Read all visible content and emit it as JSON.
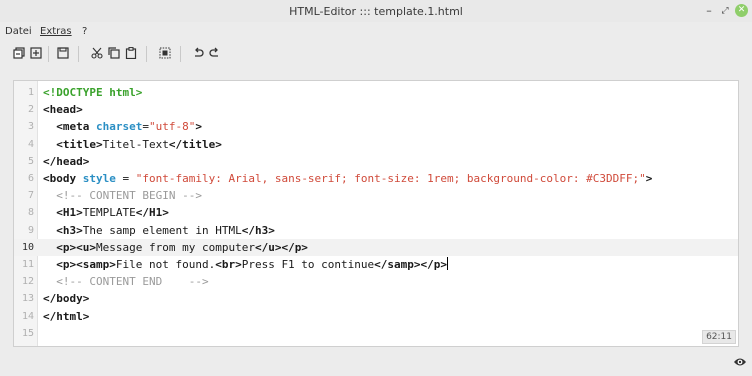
{
  "window": {
    "title": "HTML-Editor ::: template.1.html",
    "controls": {
      "minimize": "–",
      "maximize": "⤢",
      "close": "✕"
    }
  },
  "menu": [
    {
      "label": "Datei"
    },
    {
      "label": "Extras"
    },
    {
      "label": "?"
    }
  ],
  "toolbar": [
    {
      "icon": "duplicate-window-icon"
    },
    {
      "icon": "new-file-icon"
    },
    {
      "icon": "save-icon"
    },
    {
      "icon": "cut-icon"
    },
    {
      "icon": "copy-icon"
    },
    {
      "icon": "paste-icon"
    },
    {
      "icon": "select-all-icon"
    },
    {
      "icon": "undo-icon"
    },
    {
      "icon": "redo-icon"
    }
  ],
  "editor": {
    "current_line": 10,
    "cursor_position": "62:11",
    "line_numbers": [
      "1",
      "2",
      "3",
      "4",
      "5",
      "6",
      "7",
      "8",
      "9",
      "10",
      "11",
      "12",
      "13",
      "14",
      "15"
    ],
    "lines": [
      [
        {
          "t": "doctype",
          "v": "<!DOCTYPE html>"
        }
      ],
      [
        {
          "t": "tag",
          "v": "<head>"
        }
      ],
      [
        {
          "t": "txt",
          "v": "  "
        },
        {
          "t": "tag",
          "v": "<meta "
        },
        {
          "t": "attr",
          "v": "charset"
        },
        {
          "t": "txt",
          "v": "="
        },
        {
          "t": "str",
          "v": "\"utf-8\""
        },
        {
          "t": "tag",
          "v": ">"
        }
      ],
      [
        {
          "t": "txt",
          "v": "  "
        },
        {
          "t": "tag",
          "v": "<title>"
        },
        {
          "t": "txt",
          "v": "Titel-Text"
        },
        {
          "t": "tag",
          "v": "</title>"
        }
      ],
      [
        {
          "t": "tag",
          "v": "</head>"
        }
      ],
      [
        {
          "t": "tag",
          "v": "<body "
        },
        {
          "t": "attr",
          "v": "style"
        },
        {
          "t": "txt",
          "v": " = "
        },
        {
          "t": "str",
          "v": "\"font-family: Arial, sans-serif; font-size: 1rem; background-color: #C3DDFF;\""
        },
        {
          "t": "tag",
          "v": ">"
        }
      ],
      [
        {
          "t": "comment",
          "v": "  <!-- CONTENT BEGIN -->"
        }
      ],
      [
        {
          "t": "txt",
          "v": "  "
        },
        {
          "t": "tag",
          "v": "<H1>"
        },
        {
          "t": "txt",
          "v": "TEMPLATE"
        },
        {
          "t": "tag",
          "v": "</H1>"
        }
      ],
      [
        {
          "t": "txt",
          "v": "  "
        },
        {
          "t": "tag",
          "v": "<h3>"
        },
        {
          "t": "txt",
          "v": "The samp element in HTML"
        },
        {
          "t": "tag",
          "v": "</h3>"
        }
      ],
      [
        {
          "t": "txt",
          "v": "  "
        },
        {
          "t": "tag",
          "v": "<p><u>"
        },
        {
          "t": "txt",
          "v": "Message from my computer"
        },
        {
          "t": "tag",
          "v": "</u></p>"
        }
      ],
      [
        {
          "t": "txt",
          "v": "  "
        },
        {
          "t": "tag",
          "v": "<p><samp>"
        },
        {
          "t": "txt",
          "v": "File not found."
        },
        {
          "t": "tag",
          "v": "<br>"
        },
        {
          "t": "txt",
          "v": "Press F1 to continue"
        },
        {
          "t": "tag",
          "v": "</samp></p>"
        },
        {
          "t": "caret",
          "v": ""
        }
      ],
      [
        {
          "t": "comment",
          "v": "  <!-- CONTENT END    -->"
        }
      ],
      [
        {
          "t": "tag",
          "v": "</body>"
        }
      ],
      [
        {
          "t": "tag",
          "v": "</html>"
        }
      ],
      []
    ]
  },
  "status": {
    "eye_icon": "eye-icon"
  }
}
